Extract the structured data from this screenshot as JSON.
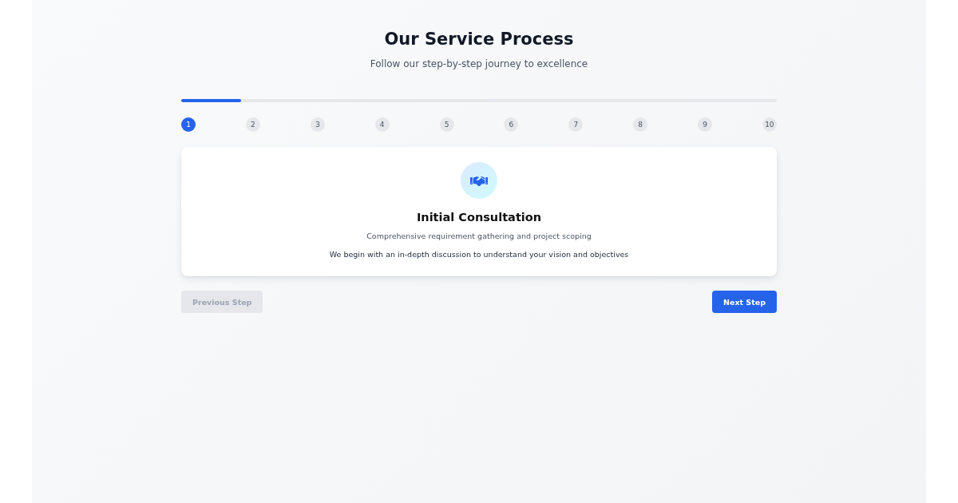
{
  "header": {
    "title": "Our Service Process",
    "subtitle": "Follow our step-by-step journey to excellence"
  },
  "progress": {
    "level": 0.1
  },
  "steps": [
    {
      "label": "1",
      "selected": true
    },
    {
      "label": "2",
      "selected": false
    },
    {
      "label": "3",
      "selected": false
    },
    {
      "label": "4",
      "selected": false
    },
    {
      "label": "5",
      "selected": false
    },
    {
      "label": "6",
      "selected": false
    },
    {
      "label": "7",
      "selected": false
    },
    {
      "label": "8",
      "selected": false
    },
    {
      "label": "9",
      "selected": false
    },
    {
      "label": "10",
      "selected": false
    }
  ],
  "card": {
    "title": "Initial Consultation",
    "summary": "Comprehensive requirement gathering and project scoping",
    "description": "We begin with an in-depth discussion to understand your vision and objectives"
  },
  "buttons": [
    {
      "label": "Previous Step",
      "kind": "secondary",
      "disabled": true
    },
    {
      "label": "Next Step",
      "kind": "primary",
      "disabled": false
    }
  ]
}
